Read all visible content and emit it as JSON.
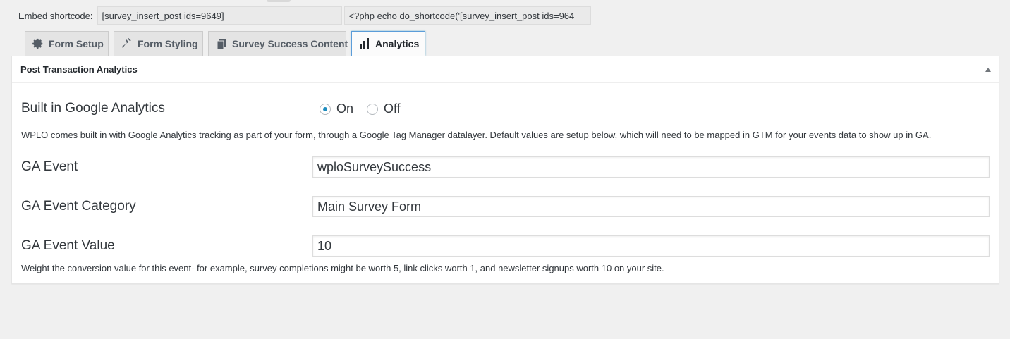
{
  "shortcode": {
    "label": "Embed shortcode:",
    "value": "[survey_insert_post ids=9649]",
    "php_value": "<?php echo do_shortcode('[survey_insert_post ids=964"
  },
  "tabs": [
    {
      "label": "Form Setup",
      "icon": "gear-icon",
      "active": false
    },
    {
      "label": "Form Styling",
      "icon": "hammer-icon",
      "active": false
    },
    {
      "label": "Survey Success Content",
      "icon": "pages-icon",
      "active": false
    },
    {
      "label": "Analytics",
      "icon": "bar-chart-icon",
      "active": true
    }
  ],
  "panel": {
    "title": "Post Transaction Analytics",
    "ga": {
      "label": "Built in Google Analytics",
      "options": [
        "On",
        "Off"
      ],
      "selected": "On"
    },
    "ga_help": "WPLO comes built in with Google Analytics tracking as part of your form, through a Google Tag Manager datalayer. Default values are setup below, which will need to be mapped in GTM for your events data to show up in GA.",
    "event": {
      "label": "GA Event",
      "value": "wploSurveySuccess"
    },
    "category": {
      "label": "GA Event Category",
      "value": "Main Survey Form"
    },
    "value": {
      "label": "GA Event Value",
      "value": "10"
    },
    "value_help": "Weight the conversion value for this event- for example, survey completions might be worth 5, link clicks worth 1, and newsletter signups worth 10 on your site."
  },
  "colors": {
    "accent": "#1e8cbe",
    "active_tab_border": "#5b9dd9"
  }
}
